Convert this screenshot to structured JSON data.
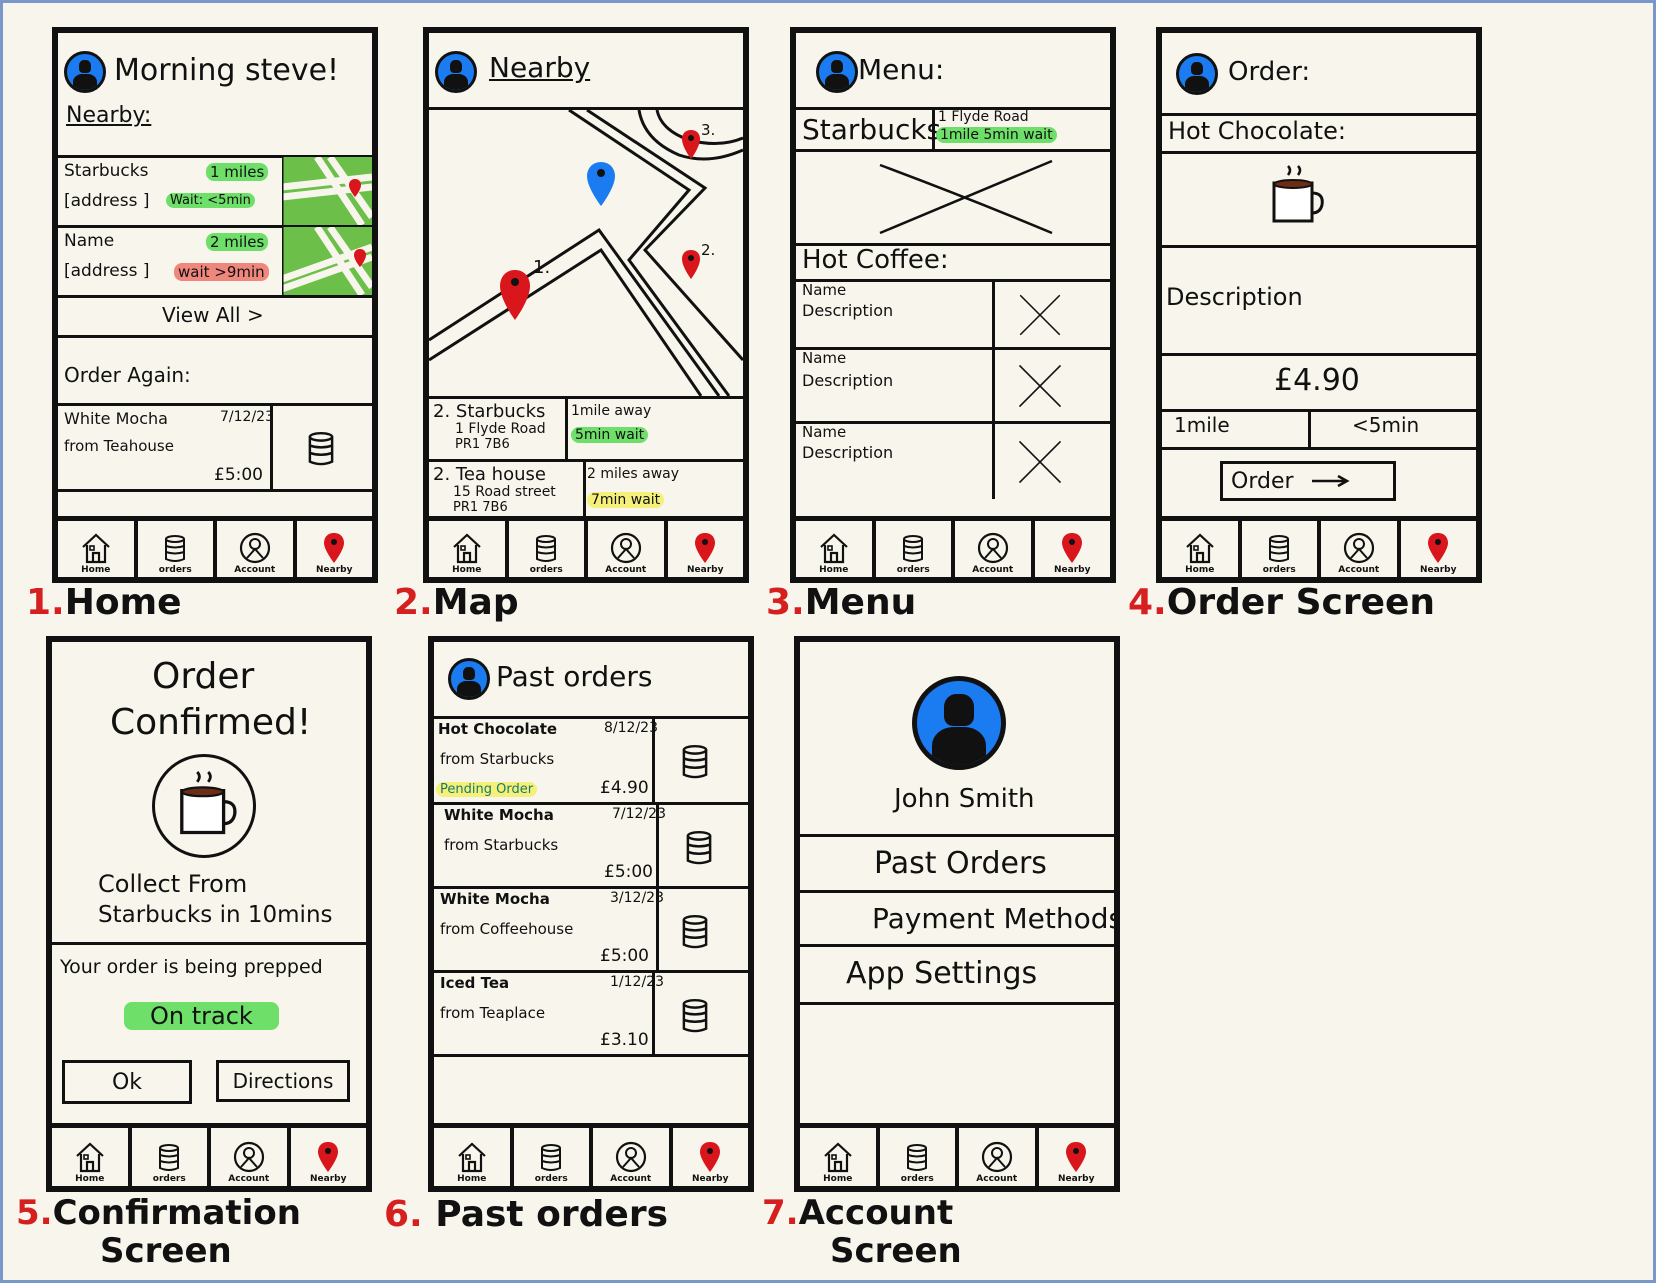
{
  "nav": {
    "home": "Home",
    "orders": "orders",
    "account": "Account",
    "nearby": "Nearby"
  },
  "colors": {
    "avatar_blue": "#1a7cf0",
    "pin_red": "#d8161b",
    "highlight_green": "#6ee06a",
    "highlight_red": "#f0877d",
    "highlight_yellow": "#f4f07a",
    "map_green": "#6cc04a",
    "caption_number": "#d61f1f"
  },
  "captions": [
    {
      "num": "1.",
      "label": "Home"
    },
    {
      "num": "2.",
      "label": "Map"
    },
    {
      "num": "3.",
      "label": "Menu"
    },
    {
      "num": "4.",
      "label": "Order Screen"
    },
    {
      "num": "5.",
      "label": "Confirmation",
      "label2": "Screen"
    },
    {
      "num": "6.",
      "label": "Past orders"
    },
    {
      "num": "7.",
      "label": "Account",
      "label2": "Screen"
    }
  ],
  "home": {
    "greeting": "Morning steve!",
    "nearby_heading": "Nearby:",
    "shops": [
      {
        "name": "Starbucks",
        "address": "[address ]",
        "distance": "1 miles",
        "wait": "Wait: <5min"
      },
      {
        "name": "Name",
        "address": "[address ]",
        "distance": "2 miles",
        "wait": "wait >9min"
      }
    ],
    "view_all": "View All >",
    "order_again": "Order Again:",
    "last_order": {
      "item": "White Mocha",
      "from": "from Teahouse",
      "date": "7/12/23",
      "price": "£5:00"
    }
  },
  "map": {
    "title": "Nearby",
    "pin_labels": [
      "1.",
      "2.",
      "3."
    ],
    "results": [
      {
        "num": "2.",
        "name": "Starbucks",
        "address": "1 Flyde Road",
        "postcode": "PR1 7B6",
        "distance": "1mile away",
        "wait": "5min wait"
      },
      {
        "num": "2.",
        "name": "Tea house",
        "address": "15 Road street",
        "postcode": "PR1 7B6",
        "distance": "2 miles away",
        "wait": "7min wait"
      }
    ]
  },
  "menu": {
    "title": "Menu:",
    "shop_name": "Starbucks",
    "shop_address": "1 Flyde Road",
    "shop_distance": "1mile",
    "shop_wait": "5min wait",
    "section": "Hot Coffee:",
    "items": [
      {
        "name": "Name",
        "desc": "Description"
      },
      {
        "name": "Name",
        "desc": "Description"
      },
      {
        "name": "Name",
        "desc": "Description"
      }
    ]
  },
  "order": {
    "title": "Order:",
    "item": "Hot Chocolate:",
    "description": "Description",
    "price": "£4.90",
    "distance": "1mile",
    "wait": "<5min",
    "order_button": "Order"
  },
  "confirm": {
    "title_line1": "Order",
    "title_line2": "Confirmed!",
    "collect_line1": "Collect From",
    "collect_line2": "Starbucks in 10mins",
    "status_text": "Your order is being prepped",
    "status_badge": "On track",
    "ok": "Ok",
    "directions": "Directions"
  },
  "past": {
    "title": "Past orders",
    "orders": [
      {
        "item": "Hot Chocolate",
        "from": "from Starbucks",
        "date": "8/12/23",
        "price": "£4.90",
        "status": "Pending Order"
      },
      {
        "item": "White Mocha",
        "from": "from Starbucks",
        "date": "7/12/23",
        "price": "£5:00",
        "status": ""
      },
      {
        "item": "White Mocha",
        "from": "from Coffeehouse",
        "date": "3/12/23",
        "price": "£5:00",
        "status": ""
      },
      {
        "item": "Iced Tea",
        "from": "from Teaplace",
        "date": "1/12/23",
        "price": "£3.10",
        "status": ""
      }
    ]
  },
  "account": {
    "name": "John Smith",
    "menu": [
      "Past Orders",
      "Payment Methods",
      "App Settings"
    ]
  }
}
